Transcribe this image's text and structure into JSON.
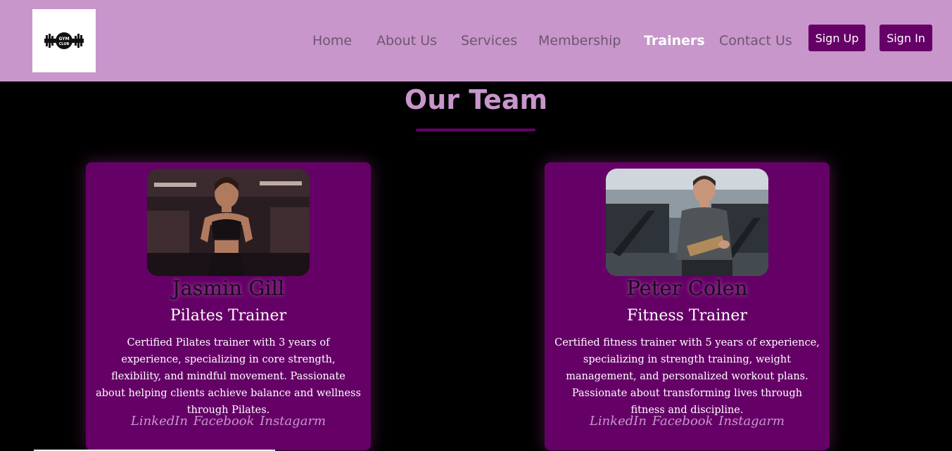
{
  "brand": {
    "logo_text_top": "GYM",
    "logo_text_bottom": "CLUB"
  },
  "nav": {
    "items": [
      {
        "label": "Home",
        "active": false
      },
      {
        "label": "About Us",
        "active": false
      },
      {
        "label": "Services",
        "active": false
      },
      {
        "label": "Membership",
        "active": false
      },
      {
        "label": "Trainers",
        "active": true
      },
      {
        "label": "Contact Us",
        "active": false
      }
    ],
    "sign_up_label": "Sign Up",
    "sign_in_label": "Sign In"
  },
  "section": {
    "title": "Our Team"
  },
  "trainers": [
    {
      "name": "Jasmin Gill",
      "role": "Pilates Trainer",
      "bio": "Certified Pilates trainer with 3 years of experience, specializing in core strength, flexibility, and mindful movement. Passionate about helping clients achieve balance and wellness through Pilates.",
      "socials": [
        "LinkedIn",
        "Facebook",
        "Instagarm"
      ]
    },
    {
      "name": "Peter Colen",
      "role": "Fitness Trainer",
      "bio": "Certified fitness trainer with 5 years of experience, specializing in strength training, weight management, and personalized workout plans. Passionate about transforming lives through fitness and discipline.",
      "socials": [
        "LinkedIn",
        "Facebook",
        "Instagarm"
      ]
    }
  ],
  "colors": {
    "nav_bg": "#c896cb",
    "accent": "#650067",
    "page_bg": "#000000",
    "active_link": "#ffffff",
    "link": "#6e5570"
  }
}
